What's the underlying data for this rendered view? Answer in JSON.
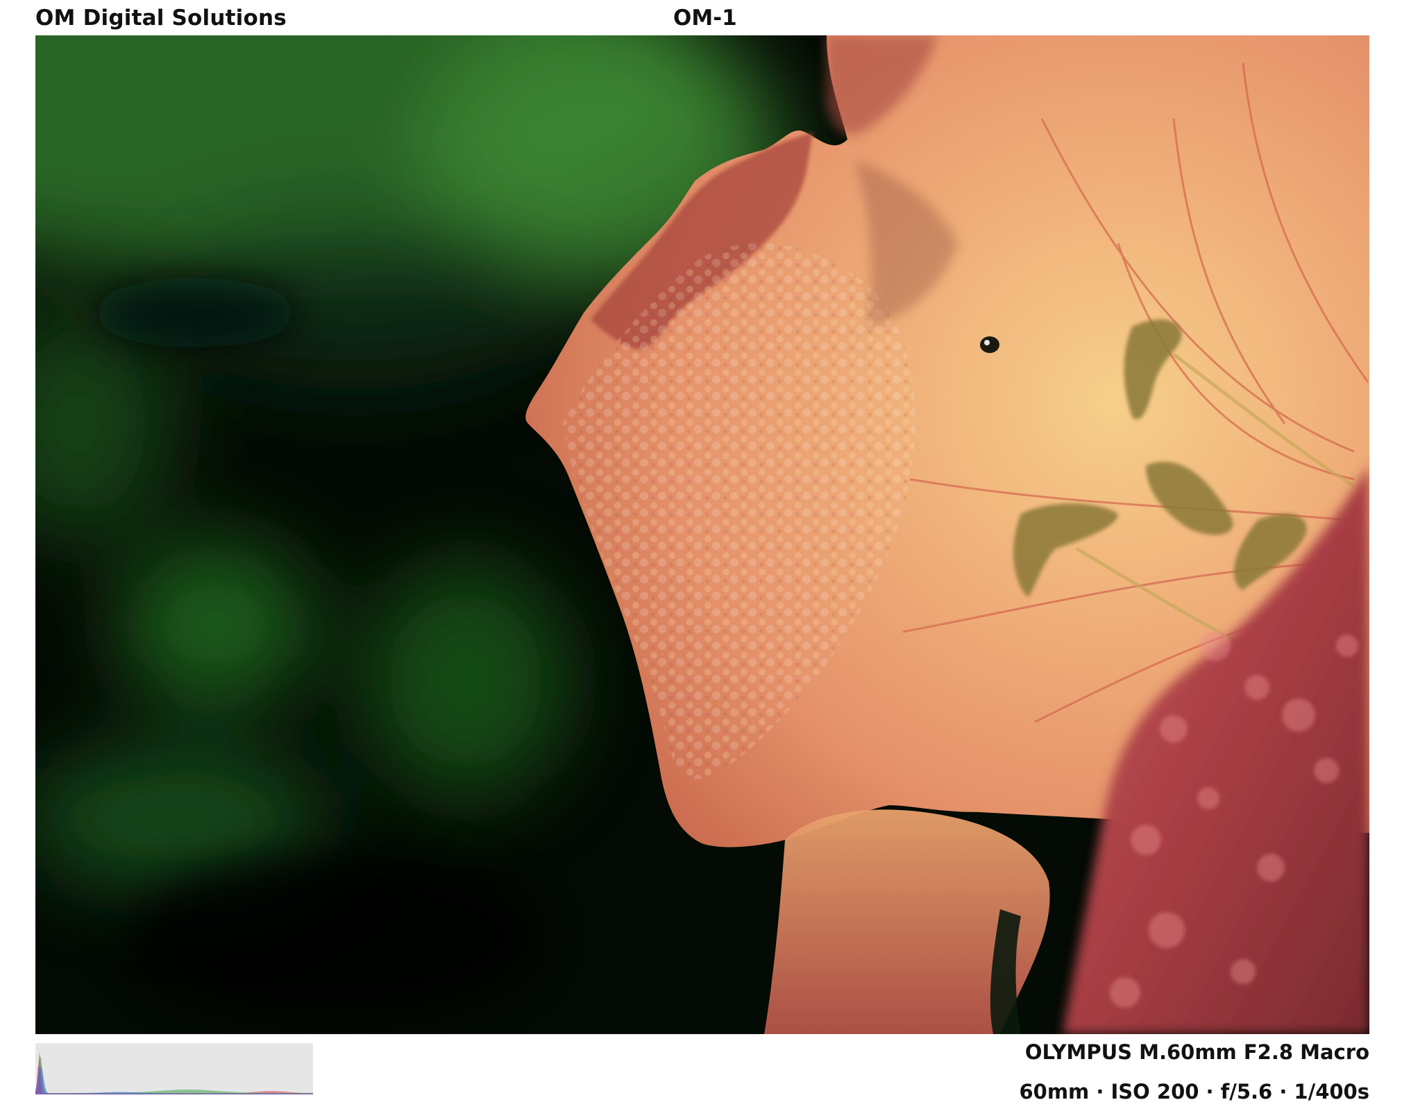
{
  "header": {
    "brand": "OM Digital Solutions",
    "camera_model": "OM-1"
  },
  "photo": {
    "subject": "lily-petal-with-water-droplets",
    "colors": {
      "background_dark": "#040a04",
      "foliage_green": "#2f7a2c",
      "petal_orange": "#e99a6a",
      "petal_edge_red": "#9c3b35",
      "throat_yellow": "#f2c27a",
      "foreground_petal_red": "#b3444a"
    }
  },
  "footer": {
    "lens": "OLYMPUS M.60mm F2.8 Macro",
    "exposure": "60mm · ISO 200 · f/5.6 · 1/400s"
  },
  "histogram": {
    "background": "#e6e6e6",
    "channel_colors": [
      "#d0404a",
      "#3fa04a",
      "#3a6fd0",
      "#a040c0"
    ]
  }
}
